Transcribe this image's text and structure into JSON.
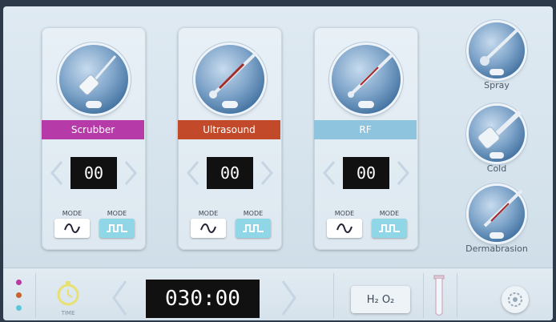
{
  "panels": [
    {
      "label": "Scrubber",
      "color": "#b63aa8",
      "counter": "00",
      "mode_a": "MODE",
      "mode_b": "MODE"
    },
    {
      "label": "Ultrasound",
      "color": "#c24a2a",
      "counter": "00",
      "mode_a": "MODE",
      "mode_b": "MODE"
    },
    {
      "label": "RF",
      "color": "#8fc4df",
      "counter": "00",
      "mode_a": "MODE",
      "mode_b": "MODE"
    }
  ],
  "side": [
    {
      "label": "Spray"
    },
    {
      "label": "Cold"
    },
    {
      "label": "Dermabrasion"
    }
  ],
  "bottom": {
    "time_label": "TIME",
    "timer_value": "030:00",
    "h2o2_label": "H₂ O₂",
    "status_dots": [
      "#b83aa0",
      "#c8622e",
      "#5cc6d8"
    ]
  },
  "icons": {
    "sine": "sine-wave-icon",
    "pulse": "square-wave-icon",
    "timer": "stopwatch-icon",
    "settings": "gear-icon",
    "tube": "test-tube-icon"
  }
}
